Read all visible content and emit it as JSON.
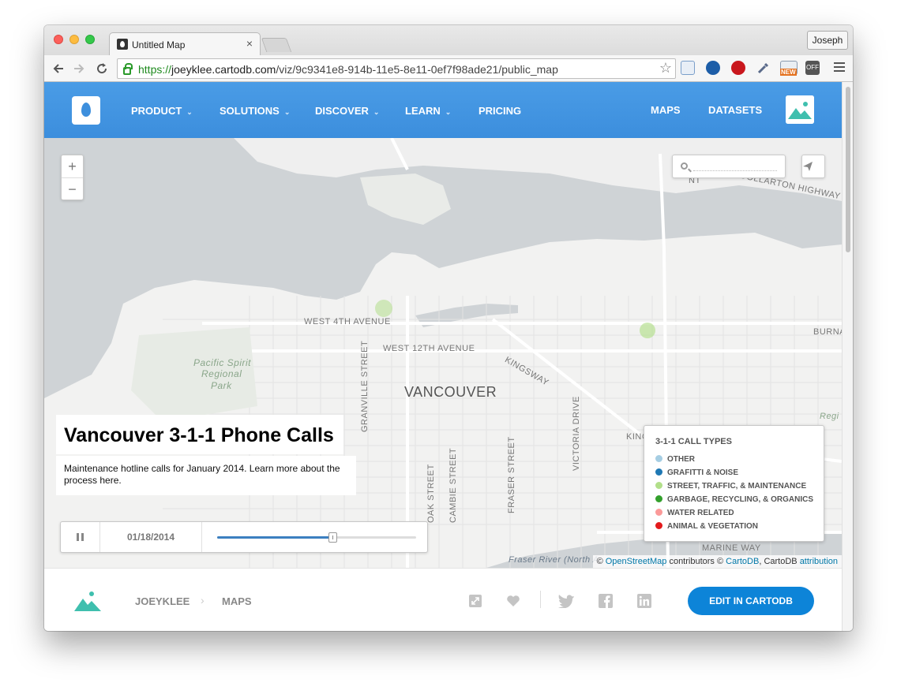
{
  "browser": {
    "tab_title": "Untitled Map",
    "tab_close": "×",
    "profile_name": "Joseph",
    "url_scheme": "https://",
    "url_domain": "joeyklee.cartodb.com",
    "url_path": "/viz/9c9341e8-914b-11e5-8e11-0ef7f98ade21/public_map",
    "back_icon": "back-arrow-icon",
    "forward_icon": "forward-arrow-icon",
    "reload_icon": "reload-icon",
    "extension_new_badge": "NEW",
    "extension_off_badge": "OFF"
  },
  "header": {
    "nav": [
      {
        "label": "PRODUCT"
      },
      {
        "label": "SOLUTIONS"
      },
      {
        "label": "DISCOVER"
      },
      {
        "label": "LEARN"
      },
      {
        "label": "PRICING"
      }
    ],
    "right_links": [
      {
        "label": "MAPS"
      },
      {
        "label": "DATASETS"
      }
    ],
    "colors": {
      "bar": "#3c8edd"
    }
  },
  "map": {
    "labels": {
      "vancouver": "VANCOUVER",
      "west_4th": "WEST 4TH AVENUE",
      "west_12th": "WEST 12TH AVENUE",
      "kingsway": "KINGSWAY",
      "kingsway_cut": "KING",
      "granville": "GRANVILLE STREET",
      "oak": "OAK STREET",
      "cambie": "CAMBIE STREET",
      "fraser": "FRASER STREET",
      "victoria": "VICTORIA DRIVE",
      "marine": "MARINE WAY",
      "dollarton": "DOLLARTON HIGHWAY",
      "burnaby_cut": "BURNA",
      "regional_cut": "Regi",
      "north_cut": "NT",
      "fraser_river": "Fraser River (North A",
      "pacific_spirit_1": "Pacific Spirit",
      "pacific_spirit_2": "Regional",
      "pacific_spirit_3": "Park"
    },
    "zoom_in": "+",
    "zoom_out": "−",
    "title": "Vancouver 3-1-1 Phone Calls",
    "description": "Maintenance hotline calls for January 2014. Learn more about the process here.",
    "timeslider": {
      "date": "01/18/2014",
      "progress": 0.58
    },
    "legend": {
      "title": "3-1-1 CALL TYPES",
      "items": [
        {
          "label": "OTHER",
          "color": "#a6cee3"
        },
        {
          "label": "GRAFITTI & NOISE",
          "color": "#1f78b4"
        },
        {
          "label": "STREET, TRAFFIC, & MAINTENANCE",
          "color": "#b2df8a"
        },
        {
          "label": "GARBAGE, RECYCLING, & ORGANICS",
          "color": "#33a02c"
        },
        {
          "label": "WATER RELATED",
          "color": "#fb9a99"
        },
        {
          "label": "ANIMAL & VEGETATION",
          "color": "#e31a1c"
        }
      ]
    },
    "attribution": {
      "prefix": "© ",
      "osm": "OpenStreetMap",
      "mid": " contributors © ",
      "cartodb": "CartoDB",
      "mid2": ", CartoDB ",
      "attr": "attribution"
    }
  },
  "footer": {
    "user": "JOEYKLEE",
    "separator": "›",
    "section": "MAPS",
    "edit_button": "EDIT IN CARTODB"
  }
}
